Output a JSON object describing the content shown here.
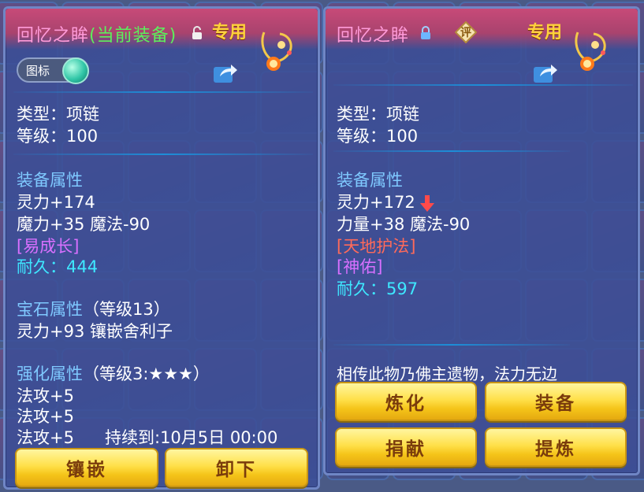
{
  "left_panel": {
    "title_name": "回忆之眸",
    "title_suffix": "(当前装备)",
    "exclusive_label": "专用",
    "tag_label": "图标",
    "type_line": "类型：项链",
    "level_line": "等级：100",
    "equip_attr_heading": "装备属性",
    "attr_lines": [
      "灵力+174",
      "魔力+35 魔法-90"
    ],
    "special_trait": "[易成长]",
    "durability_label": "耐久：",
    "durability_value": "444",
    "gem_heading": "宝石属性",
    "gem_level": "（等级13）",
    "gem_line": "灵力+93 镶嵌舍利子",
    "enhance_heading": "强化属性",
    "enhance_level": "（等级3:★★★）",
    "enhance_lines": [
      "法攻+5",
      "法攻+5",
      "法攻+5"
    ],
    "enhance_expiry": "持续到:10月5日 00:00",
    "buttons": [
      "镶嵌",
      "卸下"
    ]
  },
  "right_panel": {
    "title_name": "回忆之眸",
    "review_badge": "评",
    "exclusive_label": "专用",
    "type_line": "类型：项链",
    "level_line": "等级：100",
    "equip_attr_heading": "装备属性",
    "attr_line_1": "灵力+172",
    "attr_line_2": "力量+38 魔法-90",
    "special_trait_1": "[天地护法]",
    "special_trait_2": "[神佑]",
    "durability_label": "耐久：",
    "durability_value": "597",
    "description": "相传此物乃佛主遗物，法力无边",
    "buttons": [
      "炼化",
      "装备",
      "捐献",
      "提炼"
    ]
  },
  "colors": {
    "title_pink": "#ff9bd9",
    "current_equip_green": "#5cf05c",
    "exclusive_gold": "#ffd23c",
    "section_blue": "#7fc9ff",
    "trait_purple": "#d970ff",
    "trait_red": "#ff6a5a",
    "durability_cyan": "#3ee8ff",
    "button_text_brown": "#7a3c0c"
  },
  "icons": {
    "lock_open": "open-lock-icon",
    "lock_closed": "closed-lock-icon",
    "share": "share-icon",
    "item": "necklace-icon",
    "decrease_arrow": "red-down-arrow-icon"
  }
}
